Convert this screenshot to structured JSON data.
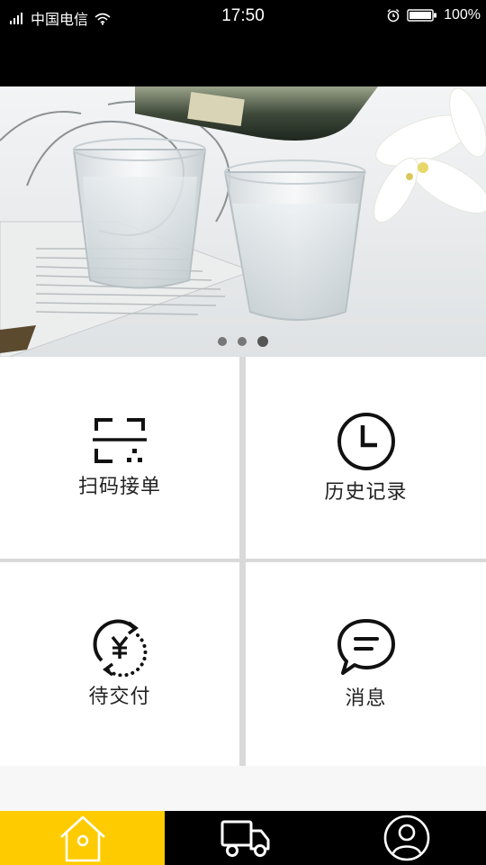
{
  "status_bar": {
    "carrier": "中国电信",
    "time": "17:50",
    "battery": "100%"
  },
  "banner": {
    "slide_count": 3,
    "active_slide": 3
  },
  "menu": {
    "items": [
      {
        "label": "扫码接单",
        "icon": "scan-icon"
      },
      {
        "label": "历史记录",
        "icon": "clock-icon"
      },
      {
        "label": "待交付",
        "icon": "yuan-refresh-icon"
      },
      {
        "label": "消息",
        "icon": "chat-bubble-icon"
      }
    ]
  },
  "tab_bar": {
    "active": "home",
    "tabs": [
      {
        "id": "home",
        "icon": "home-icon"
      },
      {
        "id": "delivery",
        "icon": "truck-icon"
      },
      {
        "id": "profile",
        "icon": "user-icon"
      }
    ]
  },
  "colors": {
    "accent": "#fecb00",
    "bar": "#000000",
    "divider": "#d9d9d9"
  }
}
